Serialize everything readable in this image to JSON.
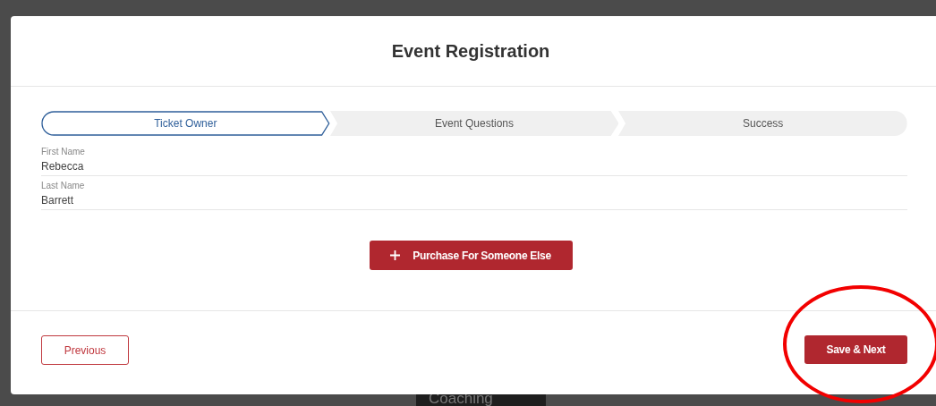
{
  "backdrop": {
    "label": "Coaching"
  },
  "dialog": {
    "title": "Event Registration"
  },
  "steps": [
    {
      "label": "Ticket Owner",
      "selected": true
    },
    {
      "label": "Event Questions",
      "selected": false
    },
    {
      "label": "Success",
      "selected": false
    }
  ],
  "fields": [
    {
      "label": "First Name",
      "value": "Rebecca"
    },
    {
      "label": "Last Name",
      "value": "Barrett"
    }
  ],
  "add_button": {
    "label": "Purchase For Someone Else"
  },
  "footer": {
    "previous": "Previous",
    "next": "Save & Next"
  },
  "annotation": {
    "kind": "circle"
  }
}
